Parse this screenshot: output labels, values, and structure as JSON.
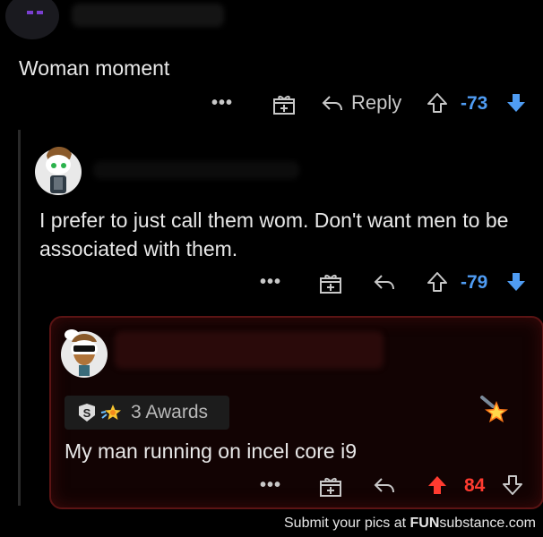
{
  "comments": [
    {
      "text": "Woman moment",
      "actions": {
        "more": "•••",
        "reply_label": "Reply",
        "score": "-73"
      }
    },
    {
      "text": "I prefer to just call them wom. Don't want men to be associated with them.",
      "actions": {
        "more": "•••",
        "score": "-79"
      }
    },
    {
      "text": "My man running on incel core i9",
      "awards_label": "3 Awards",
      "actions": {
        "more": "•••",
        "score": "84"
      }
    }
  ],
  "footer": {
    "prefix": "Submit your pics at ",
    "brand_bold": "FUN",
    "brand_rest": "substance.com"
  },
  "colors": {
    "downvote": "#4f9cf3",
    "upvote": "#ff3b30",
    "highlight_border": "#5b1414"
  }
}
